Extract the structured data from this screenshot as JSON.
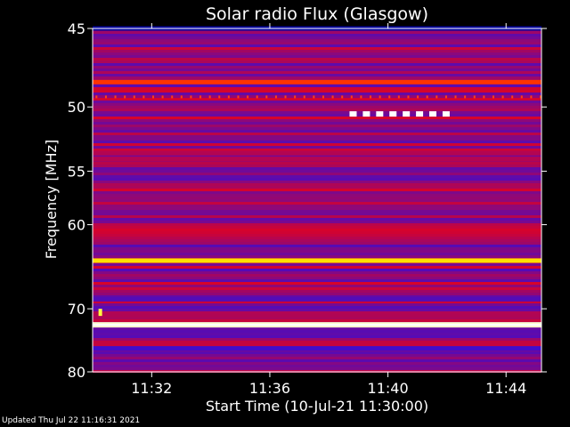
{
  "chart_data": {
    "type": "heatmap",
    "title": "Solar radio Flux (Glasgow)",
    "xlabel": "Start Time (10-Jul-21 11:30:00)",
    "ylabel": "Frequency [MHz]",
    "x_unit": "minutes after 11:30:00",
    "xlim": [
      0,
      15.2
    ],
    "ylim": [
      45,
      80
    ],
    "y_scale": "reciprocal (frequency increases downward)",
    "x_ticks": [
      {
        "value": 2,
        "label": "11:32"
      },
      {
        "value": 6,
        "label": "11:36"
      },
      {
        "value": 10,
        "label": "11:40"
      },
      {
        "value": 14,
        "label": "11:44"
      }
    ],
    "y_ticks": [
      {
        "value": 45,
        "label": "45"
      },
      {
        "value": 50,
        "label": "50"
      },
      {
        "value": 55,
        "label": "55"
      },
      {
        "value": 60,
        "label": "60"
      },
      {
        "value": 70,
        "label": "70"
      },
      {
        "value": 80,
        "label": "80"
      }
    ],
    "colorscale": [
      "#000060",
      "#1010ff",
      "#ff0000",
      "#ffff00",
      "#ffffff"
    ],
    "bands": [
      {
        "freq": 45.0,
        "level": 0.1
      },
      {
        "freq": 48.3,
        "level": 0.55
      },
      {
        "freq": 53.5,
        "level": 0.42
      },
      {
        "freq": 54.0,
        "level": 0.42
      },
      {
        "freq": 63.9,
        "level": 0.72
      },
      {
        "freq": 68.7,
        "level": 0.32
      },
      {
        "freq": 72.3,
        "level": 0.95
      },
      {
        "freq": 76.0,
        "level": 0.3
      }
    ],
    "events": [
      {
        "t_start": 8.7,
        "t_end": 12.0,
        "freq": 50.5,
        "note": "dashed bright segments"
      },
      {
        "t_start": 0.2,
        "t_end": 0.35,
        "freq": 70.5,
        "note": "small burst"
      }
    ],
    "grid": false
  },
  "footer": {
    "updated": "Updated Thu Jul 22 11:16:31 2021"
  }
}
